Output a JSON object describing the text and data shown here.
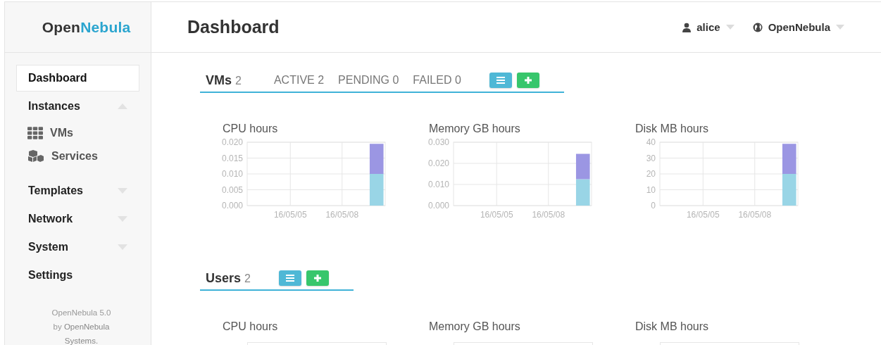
{
  "brand": {
    "part_1": "Open",
    "part_2": "Nebula"
  },
  "sidebar": {
    "items": [
      {
        "label": "Dashboard",
        "selected": true
      },
      {
        "label": "Instances",
        "selected": false,
        "expanded": true,
        "children": [
          {
            "label": "VMs",
            "selected": false
          },
          {
            "label": "Services",
            "selected": false
          }
        ]
      },
      {
        "label": "Templates",
        "selected": false,
        "expanded": false
      },
      {
        "label": "Network",
        "selected": false,
        "expanded": false
      },
      {
        "label": "System",
        "selected": false,
        "expanded": false
      },
      {
        "label": "Settings",
        "selected": false
      }
    ],
    "footer": {
      "line_1": "OpenNebula 5.0",
      "line_2_prefix": "by",
      "line_2_link": "OpenNebula",
      "line_3": "Systems."
    }
  },
  "header": {
    "title": "Dashboard",
    "user": "alice",
    "zone": "OpenNebula"
  },
  "sections": [
    {
      "title": "VMs",
      "count": "2",
      "stats": [
        "ACTIVE 2",
        "PENDING 0",
        "FAILED 0"
      ],
      "charts": [
        {
          "title": "CPU hours",
          "chart_data": {
            "type": "bar",
            "stacked": true,
            "grid": true,
            "categories": [
              null,
              null,
              "16/05/05",
              null,
              null,
              "16/05/08",
              null,
              null
            ],
            "ylim": [
              0,
              0.02
            ],
            "yticks": [
              {
                "value": 0,
                "label": "0.000"
              },
              {
                "value": 0.005,
                "label": "0.005"
              },
              {
                "value": 0.01,
                "label": "0.010"
              },
              {
                "value": 0.015,
                "label": "0.015"
              },
              {
                "value": 0.02,
                "label": "0.020"
              }
            ],
            "series": [
              {
                "color": "#99d5e6",
                "values": [
                  null,
                  null,
                  null,
                  null,
                  null,
                  null,
                  null,
                  0.01
                ]
              },
              {
                "color": "#9b96e3",
                "values": [
                  null,
                  null,
                  null,
                  null,
                  null,
                  null,
                  null,
                  0.0095
                ]
              }
            ]
          }
        },
        {
          "title": "Memory GB hours",
          "chart_data": {
            "type": "bar",
            "stacked": true,
            "grid": true,
            "categories": [
              null,
              null,
              "16/05/05",
              null,
              null,
              "16/05/08",
              null,
              null
            ],
            "ylim": [
              0,
              0.03
            ],
            "yticks": [
              {
                "value": 0,
                "label": "0.000"
              },
              {
                "value": 0.01,
                "label": "0.010"
              },
              {
                "value": 0.02,
                "label": "0.020"
              },
              {
                "value": 0.03,
                "label": "0.030"
              }
            ],
            "series": [
              {
                "color": "#99d5e6",
                "values": [
                  null,
                  null,
                  null,
                  null,
                  null,
                  null,
                  null,
                  0.0125
                ]
              },
              {
                "color": "#9b96e3",
                "values": [
                  null,
                  null,
                  null,
                  null,
                  null,
                  null,
                  null,
                  0.012
                ]
              }
            ]
          }
        },
        {
          "title": "Disk MB hours",
          "chart_data": {
            "type": "bar",
            "stacked": true,
            "grid": true,
            "categories": [
              null,
              null,
              "16/05/05",
              null,
              null,
              "16/05/08",
              null,
              null
            ],
            "ylim": [
              0,
              40
            ],
            "yticks": [
              0,
              10,
              20,
              30,
              40
            ],
            "series": [
              {
                "color": "#99d5e6",
                "values": [
                  null,
                  null,
                  null,
                  null,
                  null,
                  null,
                  null,
                  20
                ]
              },
              {
                "color": "#9b96e3",
                "values": [
                  null,
                  null,
                  null,
                  null,
                  null,
                  null,
                  null,
                  19
                ]
              }
            ]
          }
        }
      ]
    },
    {
      "title": "Users",
      "count": "2",
      "charts": [
        {
          "title": "CPU hours"
        },
        {
          "title": "Memory GB hours"
        },
        {
          "title": "Disk MB hours"
        }
      ]
    }
  ]
}
